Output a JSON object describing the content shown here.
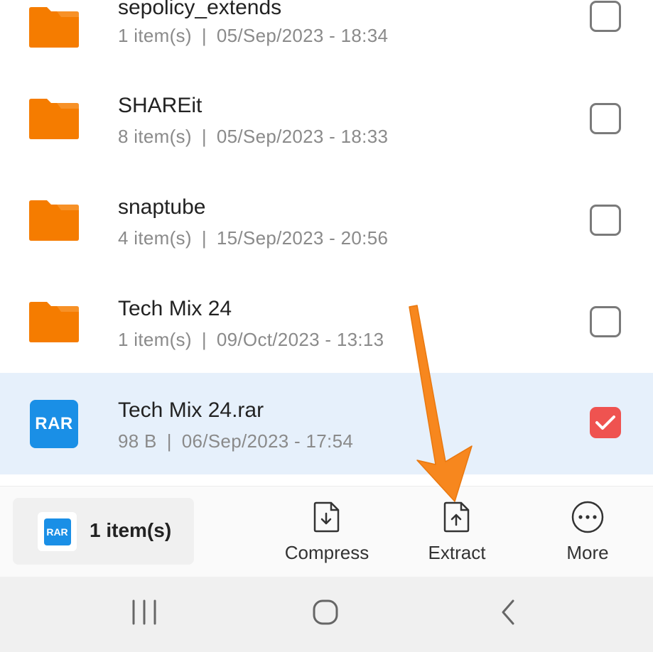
{
  "files": [
    {
      "name": "sepolicy_extends",
      "count": "1 item(s)",
      "date": "05/Sep/2023 - 18:34",
      "type": "folder",
      "checked": false
    },
    {
      "name": "SHAREit",
      "count": "8 item(s)",
      "date": "05/Sep/2023 - 18:33",
      "type": "folder",
      "checked": false
    },
    {
      "name": "snaptube",
      "count": "4 item(s)",
      "date": "15/Sep/2023 - 20:56",
      "type": "folder",
      "checked": false
    },
    {
      "name": "Tech Mix 24",
      "count": "1 item(s)",
      "date": "09/Oct/2023 - 13:13",
      "type": "folder",
      "checked": false
    },
    {
      "name": "Tech Mix 24.rar",
      "count": "98 B",
      "date": "06/Sep/2023 - 17:54",
      "type": "rar",
      "checked": true
    }
  ],
  "rar_badge": "RAR",
  "separator": "|",
  "toolbar": {
    "selection_count": "1 item(s)",
    "compress_label": "Compress",
    "extract_label": "Extract",
    "more_label": "More"
  },
  "colors": {
    "folder": "#f57c00",
    "rar": "#1a8fe6",
    "checked": "#ef5350",
    "selected_row": "#e6f0fb",
    "arrow": "#f7871e"
  },
  "icons": {
    "folder": "folder-icon",
    "rar": "rar-file-icon",
    "compress": "compress-icon",
    "extract": "extract-icon",
    "more": "more-icon",
    "recents": "recents-icon",
    "home": "home-icon",
    "back": "back-icon"
  }
}
